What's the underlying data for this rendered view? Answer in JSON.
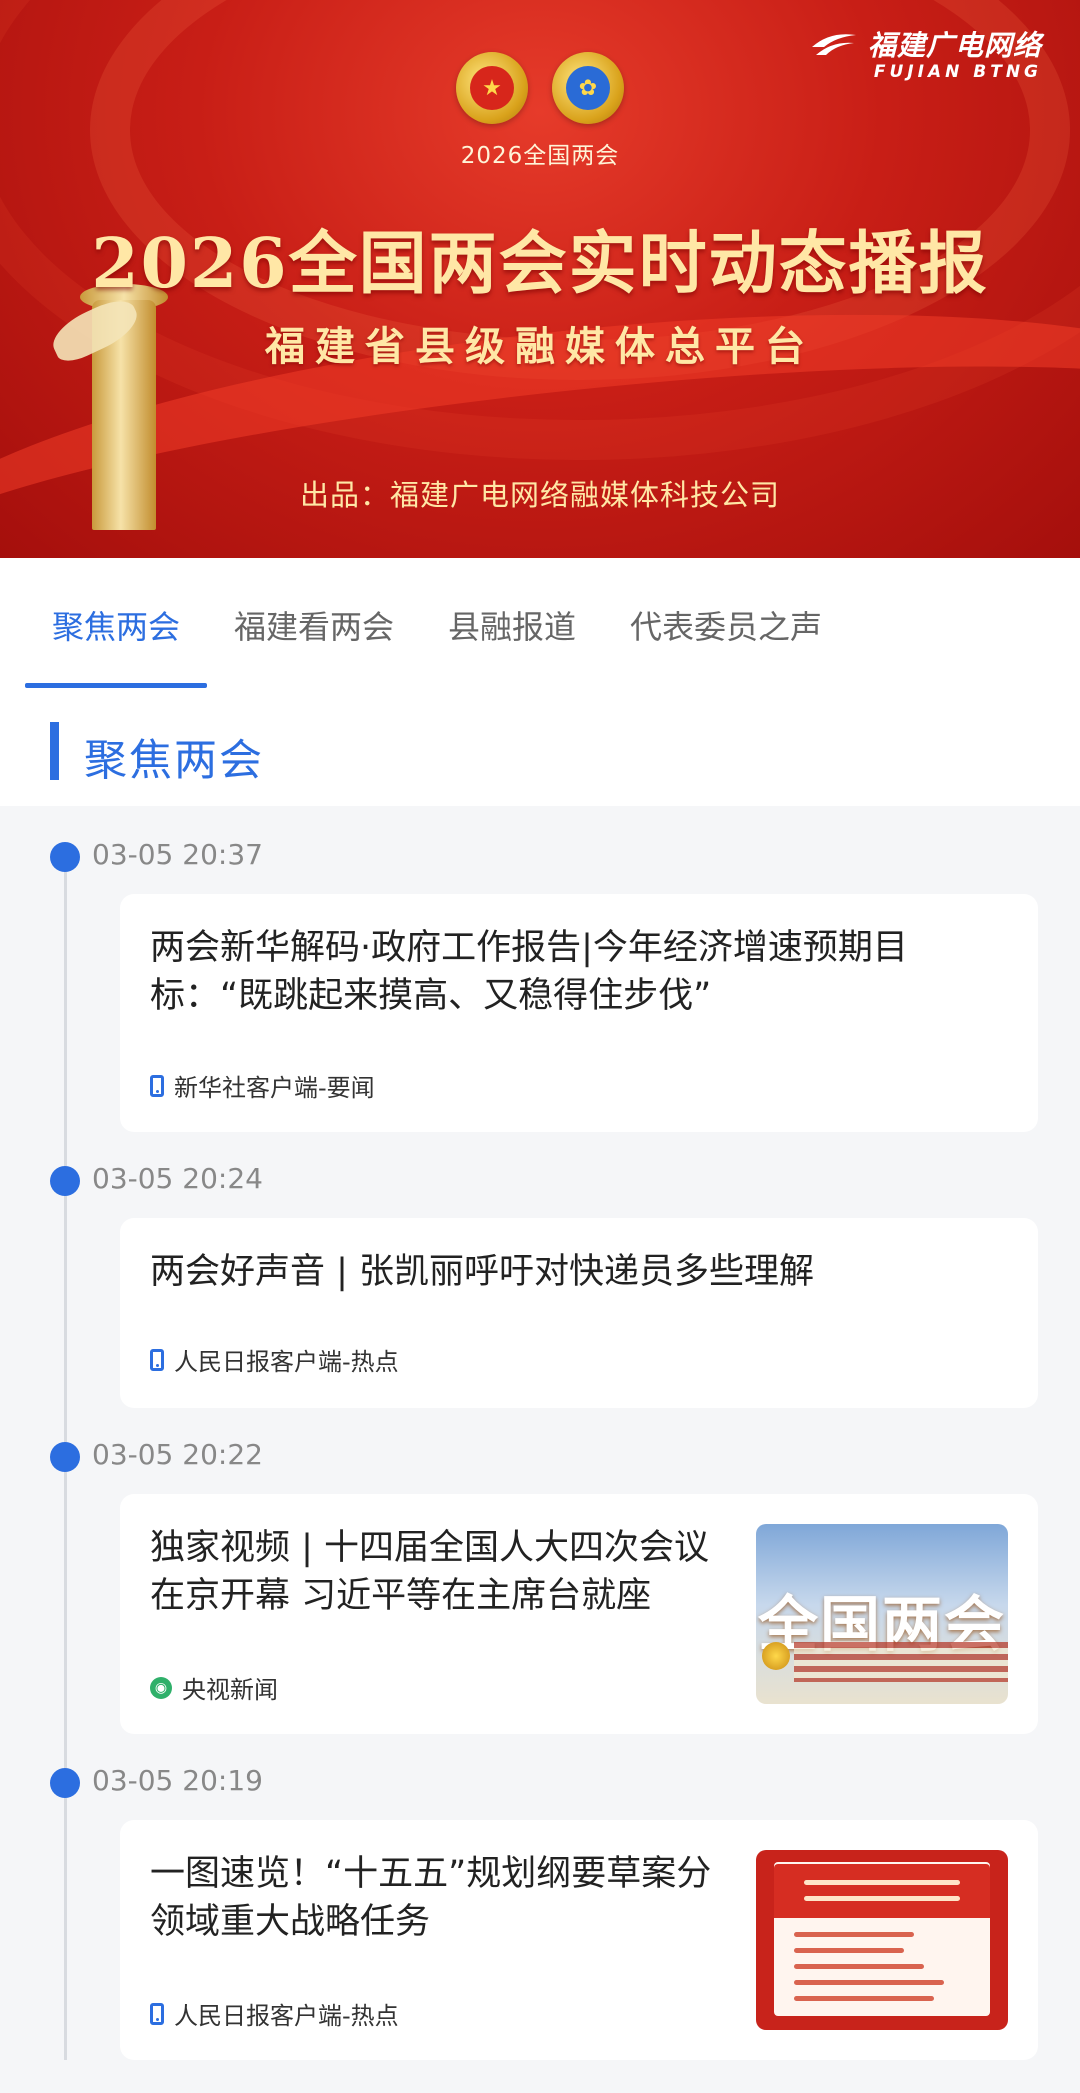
{
  "banner": {
    "brand_name": "福建广电网络",
    "brand_en": "FUJIAN BTNG",
    "event_label": "2026全国两会",
    "title": "2026全国两会实时动态播报",
    "subtitle": "福建省县级融媒体总平台",
    "producer": "出品：福建广电网络融媒体科技公司"
  },
  "tabs": [
    {
      "label": "聚焦两会",
      "active": true
    },
    {
      "label": "福建看两会",
      "active": false
    },
    {
      "label": "县融报道",
      "active": false
    },
    {
      "label": "代表委员之声",
      "active": false
    }
  ],
  "section": {
    "title": "聚焦两会"
  },
  "accent_color": "#2c6ee0",
  "timeline": [
    {
      "time": "03-05 20:37",
      "title": "两会新华解码·政府工作报告|今年经济增速预期目标：“既跳起来摸高、又稳得住步伐”",
      "source": "新华社客户端-要闻",
      "source_icon": "phone-icon"
    },
    {
      "time": "03-05 20:24",
      "title": "两会好声音 | 张凯丽呼吁对快递员多些理解",
      "source": "人民日报客户端-热点",
      "source_icon": "phone-icon"
    },
    {
      "time": "03-05 20:22",
      "title": "独家视频 | 十四届全国人大四次会议在京开幕 习近平等在主席台就座",
      "source": "央视新闻",
      "source_icon": "cctv-icon",
      "thumb_text": "全国两会"
    },
    {
      "time": "03-05 20:19",
      "title": "一图速览！“十五五”规划纲要草案分领域重大战略任务",
      "source": "人民日报客户端-热点",
      "source_icon": "phone-icon"
    }
  ]
}
